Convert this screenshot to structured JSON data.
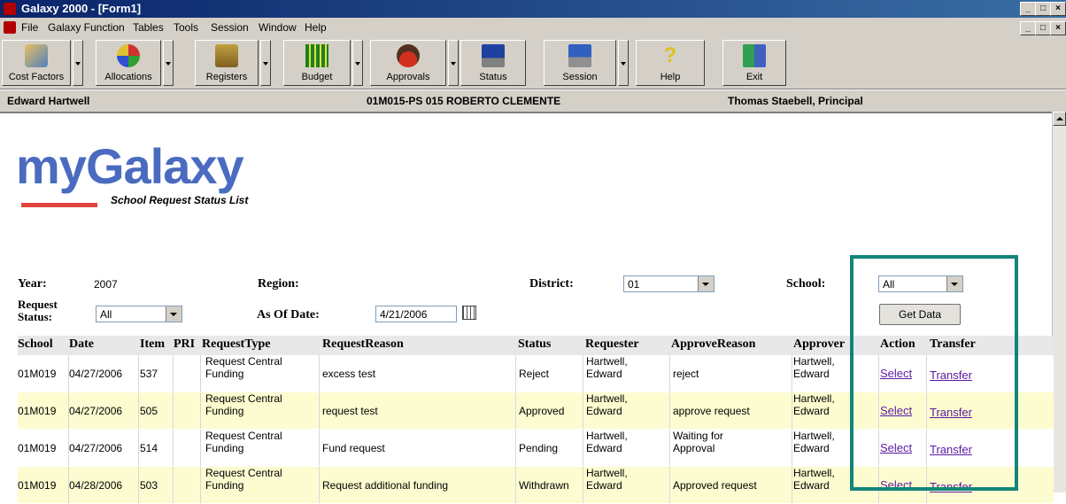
{
  "window": {
    "title": "Galaxy 2000 - [Form1]",
    "min": "_",
    "max": "□",
    "close": "×"
  },
  "menu": [
    "File",
    "Galaxy Function",
    "Tables",
    "Tools",
    "Session",
    "Window",
    "Help"
  ],
  "toolbar": [
    {
      "label": "Cost Factors",
      "icon": "cost-factors-icon"
    },
    {
      "label": "Allocations",
      "icon": "allocations-icon"
    },
    {
      "label": "Registers",
      "icon": "registers-icon"
    },
    {
      "label": "Budget",
      "icon": "budget-icon"
    },
    {
      "label": "Approvals",
      "icon": "approvals-icon"
    },
    {
      "label": "Status",
      "icon": "status-icon"
    },
    {
      "label": "Session",
      "icon": "session-icon"
    },
    {
      "label": "Help",
      "icon": "help-icon"
    },
    {
      "label": "Exit",
      "icon": "exit-icon"
    }
  ],
  "info": {
    "user": "Edward Hartwell",
    "school": "01M015-PS  015 ROBERTO CLEMENTE",
    "principal": "Thomas Staebell,  Principal"
  },
  "logo": {
    "text": "myGalaxy",
    "subtitle": "School Request Status List"
  },
  "filters": {
    "year_label": "Year:",
    "year_value": "2007",
    "region_label": "Region:",
    "district_label": "District:",
    "district_value": "01",
    "school_label": "School:",
    "school_value": "All",
    "request_status_label_1": "Request",
    "request_status_label_2": "Status:",
    "request_status_value": "All",
    "as_of_label": "As Of Date:",
    "as_of_value": "4/21/2006",
    "get_data": "Get Data"
  },
  "table": {
    "headers": [
      "School",
      "Date",
      "Item",
      "PRI",
      "RequestType",
      "RequestReason",
      "Status",
      "Requester",
      "ApproveReason",
      "Approver",
      "Action",
      "Transfer"
    ],
    "rows": [
      {
        "school": "01M019",
        "date": "04/27/2006",
        "item": "537",
        "pri": "",
        "type1": "Request Central",
        "type2": "Funding",
        "reason": "excess test",
        "status": "Reject",
        "req1": "Hartwell,",
        "req2": "Edward",
        "ar1": "reject",
        "ar2": "",
        "ap1": "Hartwell,",
        "ap2": "Edward",
        "action": "Select",
        "transfer": "Transfer",
        "bg": "white"
      },
      {
        "school": "01M019",
        "date": "04/27/2006",
        "item": "505",
        "pri": "",
        "type1": "Request Central",
        "type2": "Funding",
        "reason": "request test",
        "status": "Approved",
        "req1": "Hartwell,",
        "req2": "Edward",
        "ar1": "approve request",
        "ar2": "",
        "ap1": "Hartwell,",
        "ap2": "Edward",
        "action": "Select",
        "transfer": "Transfer",
        "bg": "yellow"
      },
      {
        "school": "01M019",
        "date": "04/27/2006",
        "item": "514",
        "pri": "",
        "type1": "Request Central",
        "type2": "Funding",
        "reason": "Fund request",
        "status": "Pending",
        "req1": "Hartwell,",
        "req2": "Edward",
        "ar1": "Waiting for",
        "ar2": "Approval",
        "ap1": "Hartwell,",
        "ap2": "Edward",
        "action": "Select",
        "transfer": "Transfer",
        "bg": "white"
      },
      {
        "school": "01M019",
        "date": "04/28/2006",
        "item": "503",
        "pri": "",
        "type1": "Request Central",
        "type2": "Funding",
        "reason": "Request additional funding",
        "status": "Withdrawn",
        "req1": "Hartwell,",
        "req2": "Edward",
        "ar1": "Approved request",
        "ar2": "",
        "ap1": "Hartwell,",
        "ap2": "Edward",
        "action": "Select",
        "transfer": "Transfer",
        "bg": "yellow"
      }
    ]
  },
  "colors": {
    "highlight": "#12857a",
    "logo": "#4a6bbf",
    "row_alt": "#fcfcd0",
    "link": "#5a1aa0"
  }
}
